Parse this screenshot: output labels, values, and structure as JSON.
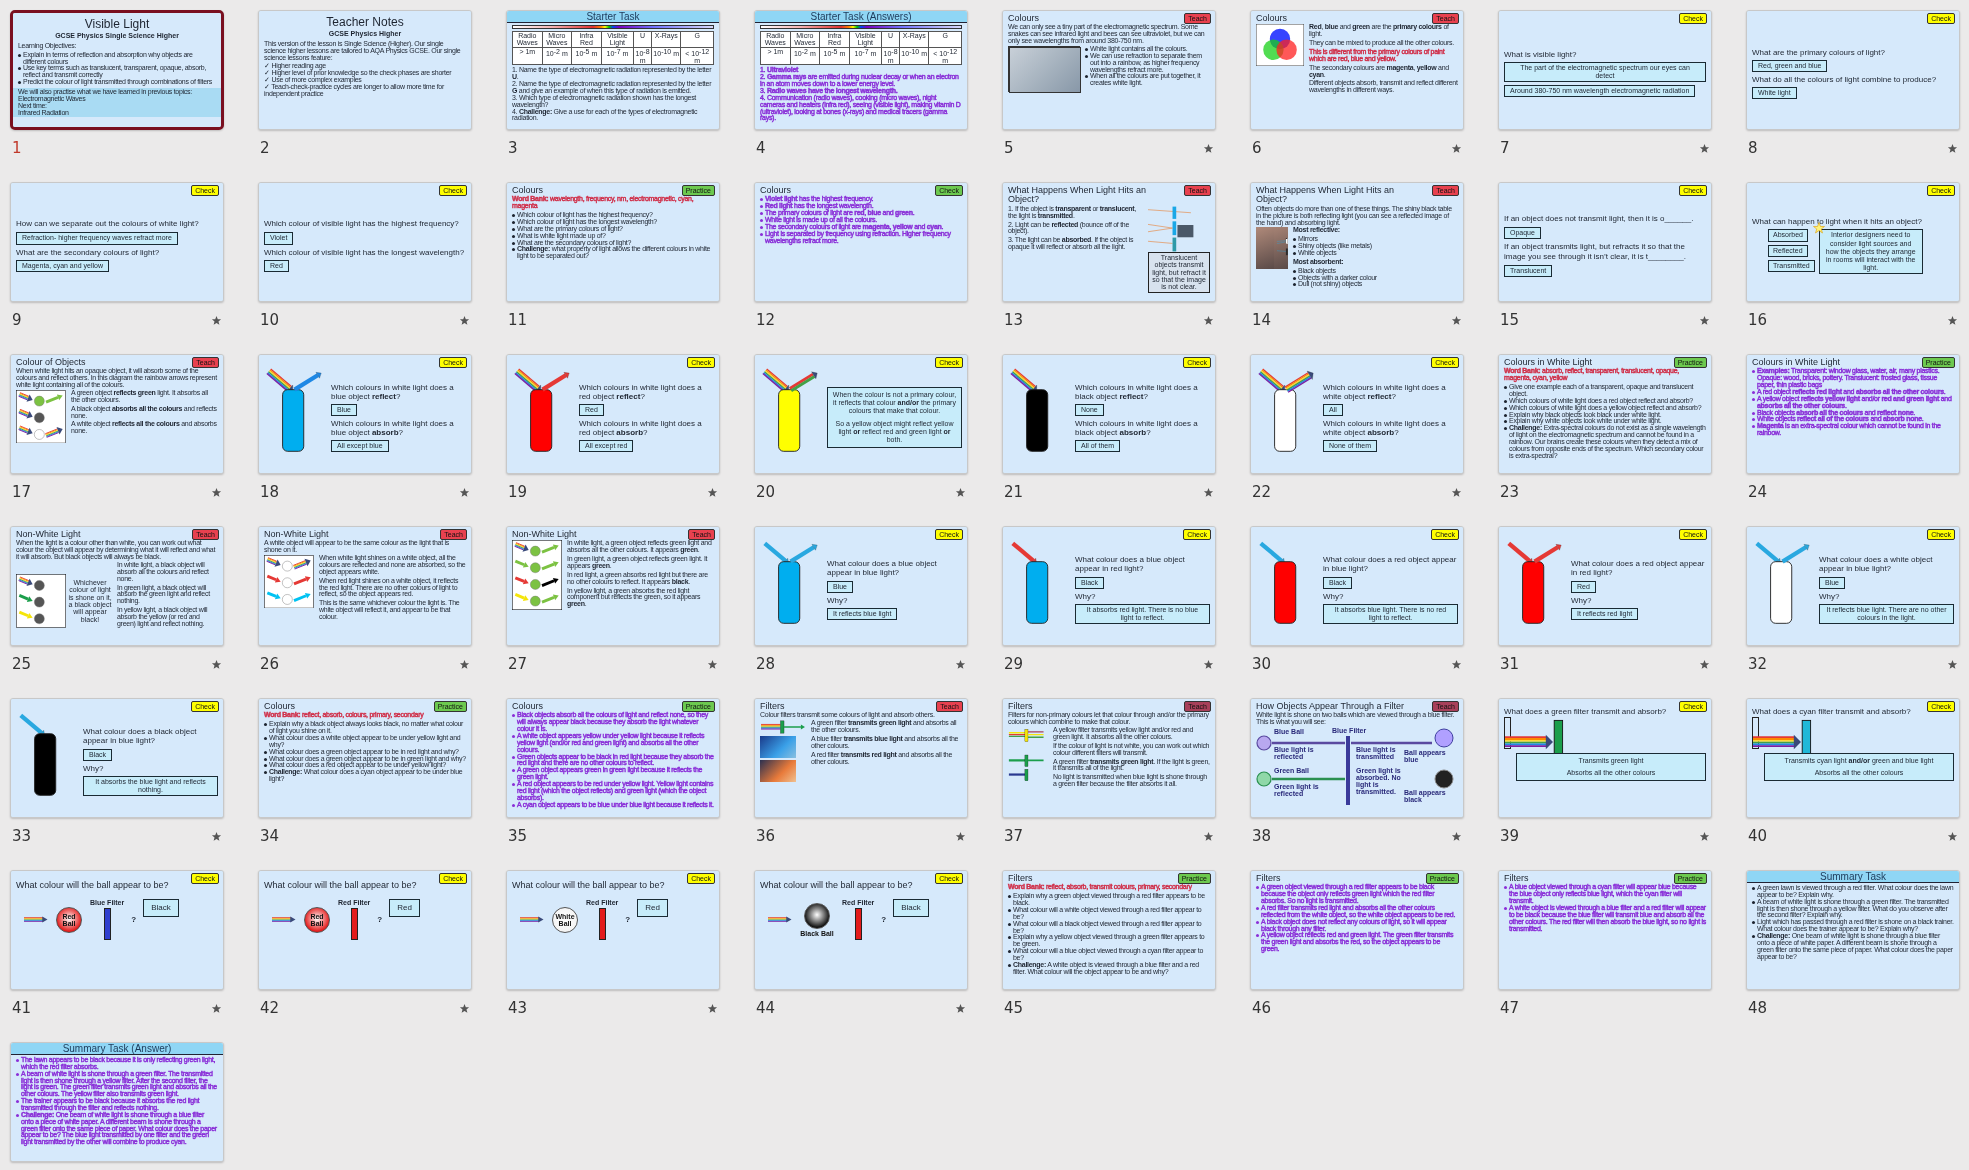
{
  "slides": [
    {
      "number": "1",
      "selected": true,
      "has_star": false,
      "kind": "title",
      "title": "Visible Light",
      "blocks": [
        {
          "kind": "subtitle",
          "text": "GCSE Physics Single Science Higher"
        },
        {
          "kind": "para",
          "text": "Learning Objectives:"
        },
        {
          "kind": "bullets",
          "items": [
            "Explain in terms of reflection and absorption why objects are different colours",
            "Use key terms such as translucent, transparent, opaque, absorb, reflect and transmit correctly",
            "Predict the colour of light transmitted through combinations of filters"
          ]
        },
        {
          "kind": "band",
          "items": [
            "We will also practise what we have learned in previous topics:",
            "Electromagnetic Waves",
            "Next time:",
            "Infrared Radiation"
          ]
        }
      ]
    },
    {
      "number": "2",
      "selected": false,
      "has_star": false,
      "kind": "title",
      "title": "Teacher Notes",
      "blocks": [
        {
          "kind": "subtitle",
          "text": "GCSE Physics Higher"
        },
        {
          "kind": "para",
          "text": "This version of the lesson is Single Science (Higher). Our single science higher lessons are tailored to AQA Physics GCSE. Our single science lessons feature:"
        },
        {
          "kind": "plain_list",
          "items": [
            "✓ Higher reading age",
            "✓ Higher level of prior knowledge so the check phases are shorter",
            "✓ Use of more complex examples",
            "✓ Teach-check-practice cycles are longer to allow more time for independent practice"
          ]
        }
      ]
    },
    {
      "number": "3",
      "selected": false,
      "has_star": false,
      "kind": "banner",
      "title": "Starter Task",
      "blocks": [
        {
          "kind": "table",
          "headers": [
            "Radio Waves",
            "Micro Waves",
            "Infra Red",
            "Visible Light",
            "U",
            "X-Rays",
            "G"
          ],
          "cells": [
            "> 1m",
            "10$^{-2}$ m",
            "10$^{-5}$ m",
            "10$^{-7}$ m",
            "10$^{-8}$ m",
            "10$^{-10}$ m",
            "< 10$^{-12}$ m"
          ]
        },
        {
          "kind": "plain_list",
          "items": [
            "1. Name the type of electromagnetic radiation represented by the letter **U**.",
            "2. Name the type of electromagnetic radiation represented by the letter **G** and give an example of when this type of radiation is emitted.",
            "3. Which type of electromagnetic radiation shown has the longest wavelength?",
            "4. **Challenge:** Give a use for each of the types of electromagnetic radiation."
          ]
        }
      ]
    },
    {
      "number": "4",
      "selected": false,
      "has_star": false,
      "kind": "banner",
      "title": "Starter Task (Answers)",
      "blocks": [
        {
          "kind": "table",
          "headers": [
            "Radio Waves",
            "Micro Waves",
            "Infra Red",
            "Visible Light",
            "U",
            "X-Rays",
            "G"
          ],
          "cells": [
            "> 1m",
            "10$^{-2}$ m",
            "10$^{-5}$ m",
            "10$^{-7}$ m",
            "10$^{-8}$ m",
            "10$^{-10}$ m",
            "< 10$^{-12}$ m"
          ]
        },
        {
          "kind": "plain_list",
          "color": "#8a30d8",
          "items": [
            "1. **Ultraviolet**",
            "2. **Gamma rays** are emitted during nuclear decay or when an electron in an atom moves down to a lower energy level.",
            "3. **Radio waves have the longest wavelength.**",
            "4. Communication (radio waves), cooking (micro waves), night cameras and heaters (infra red), seeing (visible light), making vitamin D (ultraviolet), looking at bones (x-rays) and medical tracers (gamma rays)."
          ]
        }
      ]
    },
    {
      "number": "5",
      "selected": false,
      "has_star": true,
      "kind": "text",
      "title": "Colours",
      "badge": {
        "label": "Teach",
        "color": "#e8414f"
      },
      "lead": [
        {
          "kind": "para",
          "text": "We can only see a tiny part of the electromagnetic spectrum. Some snakes can see infrared light and bees can see ultraviolet, but we can only see wavelengths from around 380-750 nm."
        }
      ],
      "blocks": [
        {
          "kind": "bullets",
          "items": [
            "White light contains all the colours.",
            "We can use refraction to separate them out into a rainbow, as higher frequency wavelengths refract more.",
            "When all the colours are put together, it creates white light."
          ]
        }
      ]
    },
    {
      "number": "6",
      "selected": false,
      "has_star": true,
      "kind": "text",
      "title": "Colours",
      "badge": {
        "label": "Teach",
        "color": "#e8414f"
      },
      "blocks": [
        {
          "kind": "para",
          "text": "**Red**, **blue** and **green** are the **primary colours** of light."
        },
        {
          "kind": "para",
          "text": "They can be mixed to produce all the other colours."
        },
        {
          "kind": "para",
          "color": "#d0304a",
          "text": "This is different from the primary colours of paint which are red, blue and yellow."
        },
        {
          "kind": "para",
          "text": "The secondary colours are **magenta**, **yellow** and **cyan**."
        },
        {
          "kind": "para",
          "text": "Different objects absorb, transmit and reflect different wavelengths in different ways."
        }
      ]
    },
    {
      "number": "7",
      "selected": false,
      "has_star": true,
      "kind": "question",
      "badge": {
        "label": "Check",
        "color": "#ffff00"
      },
      "blocks": [
        {
          "kind": "question",
          "text": "What is visible light?"
        },
        {
          "kind": "answer",
          "text": "The part of the electromagnetic spectrum our eyes can detect"
        },
        {
          "kind": "answer",
          "text": "Around 380-750 nm wavelength electromagnetic radiation"
        }
      ]
    },
    {
      "number": "8",
      "selected": false,
      "has_star": true,
      "kind": "question",
      "badge": {
        "label": "Check",
        "color": "#ffff00"
      },
      "blocks": [
        {
          "kind": "question",
          "text": "What are the primary colours of light?"
        },
        {
          "kind": "answer",
          "text": "Red, green and blue"
        },
        {
          "kind": "question",
          "text": "What do all the colours of light combine to produce?"
        },
        {
          "kind": "answer",
          "text": "White light"
        }
      ]
    },
    {
      "number": "9",
      "selected": false,
      "has_star": true,
      "kind": "question",
      "badge": {
        "label": "Check",
        "color": "#ffff00"
      },
      "blocks": [
        {
          "kind": "question",
          "text": "How can we separate out the colours of white light?",
          "answer": "Refraction- higher frequency waves refract more"
        },
        {
          "kind": "question",
          "text": "What are the secondary colours of light?"
        },
        {
          "kind": "answer",
          "text": "Magenta, cyan and yellow"
        }
      ]
    },
    {
      "number": "10",
      "selected": false,
      "has_star": true,
      "kind": "question",
      "badge": {
        "label": "Check",
        "color": "#ffff00"
      },
      "blocks": [
        {
          "kind": "question",
          "text": "Which colour of visible light has the highest frequency?",
          "answer": "Violet"
        },
        {
          "kind": "question",
          "text": "Which colour of visible light has the longest wavelength?"
        },
        {
          "kind": "answer",
          "text": "Red"
        }
      ]
    },
    {
      "number": "11",
      "selected": false,
      "has_star": false,
      "kind": "text",
      "title": "Colours",
      "badge": {
        "label": "Practice",
        "color": "#6cc94f"
      },
      "blocks": [
        {
          "kind": "para",
          "color": "#d0304a",
          "text": "**Word Bank:** wavelength, frequency, nm, electromagnetic, cyan, magenta"
        },
        {
          "kind": "bullets",
          "items": [
            "Which colour of light has the highest frequency?",
            "Which colour of light has the longest wavelength?",
            "What are the primary colours of light?",
            "What is white light made up of?",
            "What are the secondary colours of light?",
            "**Challenge:** what property of light allows the different colours in white light to be separated out?"
          ]
        }
      ]
    },
    {
      "number": "12",
      "selected": false,
      "has_star": false,
      "kind": "text",
      "title": "Colours",
      "badge": {
        "label": "Check",
        "color": "#6cc94f"
      },
      "blocks": [
        {
          "kind": "bullets",
          "color": "#8a30d8",
          "items": [
            "**Violet light** has the highest frequency.",
            "**Red light** has the longest wavelength.",
            "The primary colours of light are **red**, **blue** and **green**.",
            "White light is made up of all the colours.",
            "The secondary colours of light are **magenta**, **yellow** and **cyan**.",
            "Light is separated by frequency using refraction. Higher frequency wavelengths refract more."
          ]
        }
      ]
    },
    {
      "number": "13",
      "selected": false,
      "has_star": true,
      "kind": "text",
      "title": "What Happens When Light Hits an Object?",
      "badge": {
        "label": "Teach",
        "color": "#e8414f"
      },
      "blocks": [
        {
          "kind": "para",
          "text": "1. If the object is **transparent** or **translucent**, the light is **transmitted**."
        },
        {
          "kind": "para",
          "text": "2. Light can be **reflected** (bounce off of the object)."
        },
        {
          "kind": "para",
          "text": "3. The light can be **absorbed**. If the object is opaque it will reflect or absorb all the light."
        }
      ],
      "aside": [
        {
          "kind": "caption",
          "text": "Translucent objects transmit light, but refract it so that the image is not clear."
        }
      ]
    },
    {
      "number": "14",
      "selected": false,
      "has_star": true,
      "kind": "text",
      "title": "What Happens When Light Hits an Object?",
      "badge": {
        "label": "Teach",
        "color": "#e8414f"
      },
      "lead": [
        {
          "kind": "para",
          "text": "Often objects do more than one of these things. The shiny black table in the picture is both reflecting light (you can see a reflected image of the hand) and absorbing light."
        }
      ],
      "blocks": [
        {
          "kind": "para",
          "text": "**Most reflective:**"
        },
        {
          "kind": "bullets",
          "items": [
            "Mirrors",
            "Shiny objects (like metals)",
            "White objects"
          ]
        },
        {
          "kind": "para",
          "text": "**Most absorbent:**"
        },
        {
          "kind": "bullets",
          "items": [
            "Black objects",
            "Objects with a darker colour",
            "Dull (not shiny) objects"
          ]
        }
      ]
    },
    {
      "number": "15",
      "selected": false,
      "has_star": true,
      "kind": "question",
      "badge": {
        "label": "Check",
        "color": "#ffff00"
      },
      "blocks": [
        {
          "kind": "question",
          "text": "If an object does not transmit light, then it is o______.",
          "answer": "Opaque"
        },
        {
          "kind": "question",
          "text": "If an object transmits light, but refracts it so that the image you see through it isn’t clear, it is t________.",
          "answer": "Translucent"
        }
      ]
    },
    {
      "number": "16",
      "selected": false,
      "has_star": true,
      "kind": "question",
      "badge": {
        "label": "Check",
        "color": "#ffff00"
      },
      "blocks": [
        {
          "kind": "question",
          "text": "What can happen to light when it hits an object?"
        },
        {
          "kind": "choices",
          "items": [
            "Absorbed",
            "Reflected",
            "Transmitted"
          ],
          "note": "Interior designers need to consider light sources and how the objects they arrange in rooms will interact with the light."
        }
      ]
    },
    {
      "number": "17",
      "selected": false,
      "has_star": true,
      "kind": "text",
      "title": "Colour of Objects",
      "badge": {
        "label": "Teach",
        "color": "#e8414f"
      },
      "lead": [
        {
          "kind": "para",
          "text": "When white light hits an opaque object, it will absorb some of the colours and reflect others. In this diagram the rainbow arrows represent white light containing all of the colours."
        }
      ],
      "blocks": [
        {
          "kind": "para",
          "text": "A green object **reflects green** light. It absorbs all the other colours."
        },
        {
          "kind": "para",
          "text": "A black object **absorbs all the colours** and reflects none."
        },
        {
          "kind": "para",
          "text": "A white object **reflects all the colours** and absorbs none."
        }
      ]
    },
    {
      "number": "18",
      "selected": false,
      "has_star": true,
      "kind": "question",
      "badge": {
        "label": "Check",
        "color": "#ffff00"
      },
      "blocks": [
        {
          "kind": "question",
          "text": "Which colours in white light does a blue object **reflect**?"
        },
        {
          "kind": "answer",
          "text": "Blue"
        },
        {
          "kind": "question",
          "text": "Which colours in white light does a blue object **absorb**?"
        },
        {
          "kind": "answer",
          "text": "All except blue"
        }
      ]
    },
    {
      "number": "19",
      "selected": false,
      "has_star": true,
      "kind": "question",
      "badge": {
        "label": "Check",
        "color": "#ffff00"
      },
      "blocks": [
        {
          "kind": "question",
          "text": "Which colours in white light does a red object **reflect**?"
        },
        {
          "kind": "answer",
          "text": "Red"
        },
        {
          "kind": "question",
          "text": "Which colours in white light does a red object **absorb**?"
        },
        {
          "kind": "answer",
          "text": "All except red"
        }
      ]
    },
    {
      "number": "20",
      "selected": false,
      "has_star": true,
      "kind": "question",
      "badge": {
        "label": "Check",
        "color": "#ffff00"
      },
      "blocks": [
        {
          "kind": "box",
          "lines": [
            "When the colour is not a primary colour, it reflects that colour **and/or** the primary colours that make that colour.",
            "So a yellow object might reflect yellow light **or** reflect red and green light **or** both."
          ]
        }
      ]
    },
    {
      "number": "21",
      "selected": false,
      "has_star": true,
      "kind": "question",
      "badge": {
        "label": "Check",
        "color": "#ffff00"
      },
      "blocks": [
        {
          "kind": "question",
          "text": "Which colours in white light does a black object **reflect**?"
        },
        {
          "kind": "answer",
          "text": "None"
        },
        {
          "kind": "question",
          "text": "Which colours in white light does a black object **absorb**?"
        },
        {
          "kind": "answer",
          "text": "All of them"
        }
      ]
    },
    {
      "number": "22",
      "selected": false,
      "has_star": true,
      "kind": "question",
      "badge": {
        "label": "Check",
        "color": "#ffff00"
      },
      "blocks": [
        {
          "kind": "question",
          "text": "Which colours in white light does a white object **reflect**?"
        },
        {
          "kind": "answer",
          "text": "All"
        },
        {
          "kind": "question",
          "text": "Which colours in white light does a white object **absorb**?"
        },
        {
          "kind": "answer",
          "text": "None of them"
        }
      ]
    },
    {
      "number": "23",
      "selected": false,
      "has_star": false,
      "kind": "text",
      "title": "Colours in White Light",
      "badge": {
        "label": "Practice",
        "color": "#6cc94f"
      },
      "blocks": [
        {
          "kind": "para",
          "color": "#d0304a",
          "text": "**Word Bank:** absorb, reflect, transparent, translucent, opaque, magenta, cyan, yellow"
        },
        {
          "kind": "bullets",
          "items": [
            "Give one example each of a transparent, opaque and translucent object.",
            "Which colours of white light does a red object reflect and absorb?",
            "Which colours of white light does a yellow object reflect and absorb?",
            "Explain why black objects look black under white light.",
            "Explain why white objects look white under white light.",
            "**Challenge:** Extra-spectral colours do not exist as a single wavelength of light on the electromagnetic spectrum and cannot be found in a rainbow. Our brains create these colours when they detect a mix of colours from opposite ends of the spectrum. Which secondary colour is extra-spectral?"
          ]
        }
      ]
    },
    {
      "number": "24",
      "selected": false,
      "has_star": false,
      "kind": "text",
      "title": "Colours in White Light",
      "badge": {
        "label": "Practice",
        "color": "#6cc94f"
      },
      "blocks": [
        {
          "kind": "bullets",
          "color": "#8a30d8",
          "items": [
            "**Examples:** Transparent: window glass, water, air, many plastics. Opaque: wood, bricks, pottery. Translucent: frosted glass, tissue paper, thin plastic bags",
            "A red object **reflects red light** and **absorbs all the other colours**.",
            "A yellow object **reflects yellow light** and/or **red and green light** and **absorbs all the other colours**.",
            "Black objects **absorb all the colours** and **reflect none**.",
            "White objects **reflect all of the colours** and **absorb none**.",
            "**Magenta** is an extra-spectral colour which cannot be found in the rainbow."
          ]
        }
      ]
    },
    {
      "number": "25",
      "selected": false,
      "has_star": true,
      "kind": "text",
      "title": "Non-White Light",
      "badge": {
        "label": "Teach",
        "color": "#e8414f"
      },
      "lead": [
        {
          "kind": "para",
          "text": "When the light is a colour other than white, you can work out what colour the object will appear by determining what it will reflect and what it will absorb. But black objects will always be black."
        }
      ],
      "aside": [
        {
          "kind": "inset",
          "text": "Whichever colour of light is shone on it, a black object will appear black!"
        }
      ],
      "blocks": [
        {
          "kind": "para",
          "text": "In white light, a black object will absorb all the colours and reflect none."
        },
        {
          "kind": "para",
          "text": "In green light, a black object will absorb the green light and reflect nothing."
        },
        {
          "kind": "para",
          "text": "In yellow light, a black object will absorb the yellow (or red and green) light and reflect nothing."
        }
      ]
    },
    {
      "number": "26",
      "selected": false,
      "has_star": true,
      "kind": "text",
      "title": "Non-White Light",
      "badge": {
        "label": "Teach",
        "color": "#e8414f"
      },
      "lead": [
        {
          "kind": "para",
          "text": "A white object will appear to be the same colour as the light that is shone on it."
        }
      ],
      "blocks": [
        {
          "kind": "para",
          "text": "When white light shines on a white object, all the colours are reflected and none are absorbed, so the object appears white."
        },
        {
          "kind": "para",
          "text": "When red light shines on a white object, it reflects the red light. There are no other colours of light to reflect, so the object appears red."
        },
        {
          "kind": "para",
          "text": "This is the same whichever colour the light is. The white object will reflect it, and appear to be that colour."
        }
      ]
    },
    {
      "number": "27",
      "selected": false,
      "has_star": true,
      "kind": "text",
      "title": "Non-White Light",
      "badge": {
        "label": "Teach",
        "color": "#e8414f"
      },
      "blocks": [
        {
          "kind": "para",
          "text": "In white light, a green object reflects green light and absorbs all the other colours. It appears **green**."
        },
        {
          "kind": "para",
          "text": "In green light, a green object reflects green light. It appears **green**."
        },
        {
          "kind": "para",
          "text": "In red light, a green absorbs red light but there are no other colours to reflect. It appears **black**."
        },
        {
          "kind": "para",
          "text": "In yellow light, a green absorbs the red light component but reflects the green, so it appears **green**."
        }
      ]
    },
    {
      "number": "28",
      "selected": false,
      "has_star": true,
      "kind": "question",
      "badge": {
        "label": "Check",
        "color": "#ffff00"
      },
      "blocks": [
        {
          "kind": "question",
          "text": "What colour does a blue object appear in blue light?"
        },
        {
          "kind": "answer",
          "text": "Blue"
        },
        {
          "kind": "question",
          "text": "Why?"
        },
        {
          "kind": "answer",
          "text": "It reflects blue light"
        }
      ]
    },
    {
      "number": "29",
      "selected": false,
      "has_star": true,
      "kind": "question",
      "badge": {
        "label": "Check",
        "color": "#ffff00"
      },
      "blocks": [
        {
          "kind": "question",
          "text": "What colour does a blue object appear in red light?"
        },
        {
          "kind": "answer",
          "text": "Black"
        },
        {
          "kind": "question",
          "text": "Why?"
        },
        {
          "kind": "answer",
          "text": "It absorbs red light. There is no blue light to reflect."
        }
      ]
    },
    {
      "number": "30",
      "selected": false,
      "has_star": true,
      "kind": "question",
      "badge": {
        "label": "Check",
        "color": "#ffff00"
      },
      "blocks": [
        {
          "kind": "question",
          "text": "What colour does a red object appear in blue light?"
        },
        {
          "kind": "answer",
          "text": "Black"
        },
        {
          "kind": "question",
          "text": "Why?"
        },
        {
          "kind": "answer",
          "text": "It absorbs blue light. There is no red light to reflect."
        }
      ]
    },
    {
      "number": "31",
      "selected": false,
      "has_star": true,
      "kind": "question",
      "badge": {
        "label": "Check",
        "color": "#ffff00"
      },
      "blocks": [
        {
          "kind": "question",
          "text": "What colour does a red object appear in red light?"
        },
        {
          "kind": "answer",
          "text": "Red"
        },
        {
          "kind": "question",
          "text": "Why?"
        },
        {
          "kind": "answer",
          "text": "It reflects red light"
        }
      ]
    },
    {
      "number": "32",
      "selected": false,
      "has_star": true,
      "kind": "question",
      "badge": {
        "label": "Check",
        "color": "#ffff00"
      },
      "blocks": [
        {
          "kind": "question",
          "text": "What colour does a white object appear in blue light?"
        },
        {
          "kind": "answer",
          "text": "Blue"
        },
        {
          "kind": "question",
          "text": "Why?"
        },
        {
          "kind": "answer",
          "text": "It reflects blue light. There are no other colours in the light."
        }
      ]
    },
    {
      "number": "33",
      "selected": false,
      "has_star": true,
      "kind": "question",
      "badge": {
        "label": "Check",
        "color": "#ffff00"
      },
      "blocks": [
        {
          "kind": "question",
          "text": "What colour does a black object appear in blue light?"
        },
        {
          "kind": "answer",
          "text": "Black"
        },
        {
          "kind": "question",
          "text": "Why?"
        },
        {
          "kind": "answer",
          "text": "It absorbs the blue light and reflects nothing."
        }
      ]
    },
    {
      "number": "34",
      "selected": false,
      "has_star": false,
      "kind": "text",
      "title": "Colours",
      "badge": {
        "label": "Practice",
        "color": "#6cc94f"
      },
      "blocks": [
        {
          "kind": "para",
          "color": "#d0304a",
          "text": "**Word Bank:** reflect, absorb, colours, primary, secondary"
        },
        {
          "kind": "bullets",
          "items": [
            "Explain why a black object always looks black, no matter what colour of light you shine on it.",
            "What colour does a white object appear to be under yellow light and why?",
            "What colour does a green object appear to be in red light and why?",
            "What colour does a green object appear to be in green light and why?",
            "What colour does a red object appear to be under yellow light?",
            "**Challenge:** What colour does a cyan object appear to be under blue light?"
          ]
        }
      ]
    },
    {
      "number": "35",
      "selected": false,
      "has_star": false,
      "kind": "text",
      "title": "Colours",
      "badge": {
        "label": "Practice",
        "color": "#6cc94f"
      },
      "blocks": [
        {
          "kind": "bullets",
          "color": "#8a30d8",
          "items": [
            "Black objects absorb all the colours of light and reflect none, so they will always appear black because they absorb the light whatever colour it is.",
            "A white object appears yellow under yellow light because it reflects yellow light (and/or red and green light) and absorbs all the other colours.",
            "Green objects appear to be black in red light because they absorb the red light and there are no other colours to reflect.",
            "A green object appears green in green light because it reflects the green light.",
            "A red object appears to be red under yellow light. Yellow light contains red light (which the object reflects) and green light (which the object absorbs).",
            "A cyan object appears to be blue under blue light because it reflects it."
          ]
        }
      ]
    },
    {
      "number": "36",
      "selected": false,
      "has_star": true,
      "kind": "text",
      "title": "Filters",
      "badge": {
        "label": "Teach",
        "color": "#e8414f"
      },
      "lead": [
        {
          "kind": "para",
          "text": "Colour filters transmit some colours of light and absorb others."
        }
      ],
      "blocks": [
        {
          "kind": "para",
          "text": "A green filter **transmits green light** and absorbs all the other colours."
        },
        {
          "kind": "para",
          "text": "A blue filter **transmits blue light** and absorbs all the other colours."
        },
        {
          "kind": "para",
          "text": "A red filter **transmits red light** and absorbs all the other colours."
        }
      ]
    },
    {
      "number": "37",
      "selected": false,
      "has_star": true,
      "kind": "text",
      "title": "Filters",
      "badge": {
        "label": "Teach",
        "color": "#a8405a"
      },
      "lead": [
        {
          "kind": "para",
          "text": "Filters for non-primary colours let that colour through and/or the primary colours which combine to make that colour."
        }
      ],
      "blocks": [
        {
          "kind": "para",
          "text": "A yellow filter transmits yellow light and/or red and green light. It absorbs all the other colours."
        },
        {
          "kind": "para",
          "text": "If the colour of light is not white, you can work out which colour different filters will transmit."
        },
        {
          "kind": "para",
          "text": "A green filter **transmits green light**. If the light is green, it transmits all of the light."
        },
        {
          "kind": "para",
          "text": "No light is transmitted when blue light is shone through a green filter because the filter absorbs it all."
        }
      ]
    },
    {
      "number": "38",
      "selected": false,
      "has_star": true,
      "kind": "text",
      "title": "How Objects Appear Through a Filter",
      "badge": {
        "label": "Teach",
        "color": "#a8405a"
      },
      "lead": [
        {
          "kind": "para",
          "text": "White light is shone on two balls which are viewed through a blue filter. This is what you will see:"
        }
      ],
      "diagram_labels": [
        "Blue Filter",
        "Blue Ball",
        "Blue light is reflected",
        "Blue light is transmitted",
        "Ball appears blue",
        "Green Ball",
        "Green light is reflected",
        "Green light is absorbed. No light is transmitted.",
        "Ball appears black"
      ]
    },
    {
      "number": "39",
      "selected": false,
      "has_star": true,
      "kind": "question",
      "badge": {
        "label": "Check",
        "color": "#ffff00"
      },
      "lead": [
        {
          "kind": "question",
          "text": "What does a green filter transmit and absorb?"
        }
      ],
      "blocks": [
        {
          "kind": "box",
          "lines": [
            "Transmits green light",
            "Absorbs all the other colours"
          ]
        }
      ]
    },
    {
      "number": "40",
      "selected": false,
      "has_star": true,
      "kind": "question",
      "badge": {
        "label": "Check",
        "color": "#ffff00"
      },
      "lead": [
        {
          "kind": "question",
          "text": "What does a cyan filter transmit and absorb?"
        }
      ],
      "blocks": [
        {
          "kind": "box",
          "lines": [
            "Transmits cyan light **and/or** green and blue light",
            "Absorbs all the other colours"
          ]
        }
      ]
    },
    {
      "number": "41",
      "selected": false,
      "has_star": true,
      "kind": "ball",
      "title": "What colour will the ball appear to be?",
      "badge": {
        "label": "Check",
        "color": "#ffff00"
      },
      "ball": {
        "label": "Red Ball",
        "filter": "Blue Filter",
        "mark": "?",
        "answer": "Black"
      }
    },
    {
      "number": "42",
      "selected": false,
      "has_star": true,
      "kind": "ball",
      "title": "What colour will the ball appear to be?",
      "badge": {
        "label": "Check",
        "color": "#ffff00"
      },
      "ball": {
        "label": "Red Ball",
        "filter": "Red Filter",
        "mark": "?",
        "answer": "Red"
      }
    },
    {
      "number": "43",
      "selected": false,
      "has_star": true,
      "kind": "ball",
      "title": "What colour will the ball appear to be?",
      "badge": {
        "label": "Check",
        "color": "#ffff00"
      },
      "ball": {
        "label": "White Ball",
        "filter": "Red Filter",
        "mark": "?",
        "answer": "Red"
      }
    },
    {
      "number": "44",
      "selected": false,
      "has_star": true,
      "kind": "ball",
      "title": "What colour will the ball appear to be?",
      "badge": {
        "label": "Check",
        "color": "#ffff00"
      },
      "ball": {
        "label": "Black Ball",
        "filter": "Red Filter",
        "mark": "?",
        "answer": "Black"
      }
    },
    {
      "number": "45",
      "selected": false,
      "has_star": false,
      "kind": "text",
      "title": "Filters",
      "badge": {
        "label": "Practice",
        "color": "#6cc94f"
      },
      "blocks": [
        {
          "kind": "para",
          "color": "#d0304a",
          "text": "**Word Bank:** reflect, absorb, transmit colours, primary, secondary"
        },
        {
          "kind": "bullets",
          "items": [
            "Explain why a green object viewed through a red filter appears to be black.",
            "What colour will a white object viewed through a red filter appear to be?",
            "What colour will a black object viewed through a red filter appear to be?",
            "Explain why a yellow object viewed through a green filter appears to be green.",
            "What colour will a blue object viewed through a cyan filter appear to be?",
            "**Challenge:** A white object is viewed through a blue filter and a red filter. What colour will the object appear to be and why?"
          ]
        }
      ]
    },
    {
      "number": "46",
      "selected": false,
      "has_star": false,
      "kind": "text",
      "title": "Filters",
      "badge": {
        "label": "Practice",
        "color": "#6cc94f"
      },
      "blocks": [
        {
          "kind": "bullets",
          "color": "#8a30d8",
          "items": [
            "A green object viewed through a red filter appears to be black because the object only reflects green light which the red filter absorbs. So no light is transmitted.",
            "A red filter transmits red light and absorbs all the other colours reflected from the white object, so the white object appears to be red.",
            "A black object does not reflect any colours of light, so it will appear black through any filter.",
            "A yellow object reflects red and green light. The green filter transmits the green light and absorbs the red, so the object appears to be green."
          ]
        }
      ]
    },
    {
      "number": "47",
      "selected": false,
      "has_star": false,
      "kind": "text",
      "title": "Filters",
      "badge": {
        "label": "Practice",
        "color": "#6cc94f"
      },
      "blocks": [
        {
          "kind": "bullets",
          "color": "#8a30d8",
          "items": [
            "A blue object viewed through a cyan filter will appear blue because the blue object only reflects blue light, which the cyan filter will transmit.",
            "A white object is viewed through a blue filter and a red filter will appear to be black because the blue filter will transmit blue and absorb all the other colours. The red filter will then absorb the blue light, so no light is transmitted."
          ]
        }
      ]
    },
    {
      "number": "48",
      "selected": false,
      "has_star": false,
      "kind": "banner",
      "title": "Summary Task",
      "blocks": [
        {
          "kind": "bullets",
          "items": [
            "A green lawn is viewed through a red filter. What colour does the lawn appear to be? Explain why.",
            "A beam of white light is shone through a green filter. The transmitted light is then shone through a yellow filter. What do you observe after the second filter? Explain why.",
            "Light which has passed through a red filter is shone on a black trainer. What colour does the trainer appear to be? Explain why?",
            "**Challenge:** One beam of white light is shone through a blue filter onto a piece of white paper. A different beam is shone through a green filter onto the same piece of paper. What colour does the paper appear to be?"
          ]
        }
      ]
    },
    {
      "selected": false,
      "has_star": false,
      "kind": "banner",
      "title": "Summary Task (Answer)",
      "blocks": [
        {
          "kind": "bullets",
          "color": "#8a30d8",
          "items": [
            "The lawn appears to be black because it is only reflecting green light, which the red filter absorbs.",
            "A beam of white light is shone through a green filter. The transmitted light is then shone through a yellow filter. After the second filter, the light is green. The green filter transmits green light and absorbs all the other colours. The yellow filter also transmits green light.",
            "The trainer appears to be black because it absorbs the red light transmitted through the filter and reflects nothing.",
            "**Challenge:** One beam of white light is shone through a blue filter onto a piece of white paper. A different beam is shone through a green filter onto the same piece of paper. What colour does the paper appear to be? The blue light transmitted by one filter and the green light transmitted by the other will combine to produce cyan."
          ]
        }
      ]
    }
  ]
}
